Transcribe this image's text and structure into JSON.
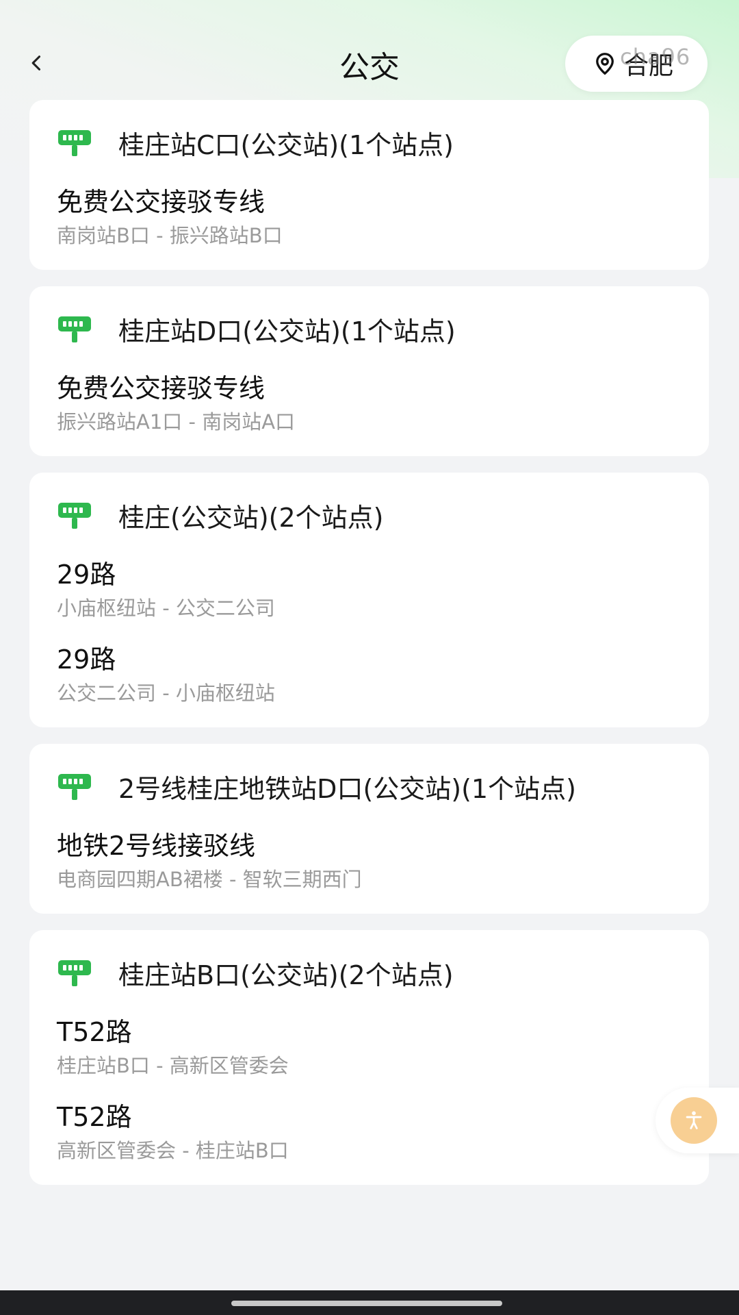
{
  "header": {
    "title": "公交",
    "city": "合肥",
    "watermark": "cha96"
  },
  "icons": {
    "back": "chevron-left-icon",
    "location": "location-pin-icon",
    "bus_stop": "bus-stop-icon",
    "accessibility": "accessibility-icon"
  },
  "colors": {
    "accent_green": "#2eb84e",
    "float_button": "#f8cf93"
  },
  "stops": [
    {
      "name": "桂庄站C口(公交站)(1个站点)",
      "routes": [
        {
          "name": "免费公交接驳专线",
          "direction": "南岗站B口 - 振兴路站B口"
        }
      ]
    },
    {
      "name": "桂庄站D口(公交站)(1个站点)",
      "routes": [
        {
          "name": "免费公交接驳专线",
          "direction": "振兴路站A1口 - 南岗站A口"
        }
      ]
    },
    {
      "name": "桂庄(公交站)(2个站点)",
      "routes": [
        {
          "name": "29路",
          "direction": "小庙枢纽站 - 公交二公司"
        },
        {
          "name": "29路",
          "direction": "公交二公司 - 小庙枢纽站"
        }
      ]
    },
    {
      "name": "2号线桂庄地铁站D口(公交站)(1个站点)",
      "routes": [
        {
          "name": "地铁2号线接驳线",
          "direction": "电商园四期AB裙楼 - 智软三期西门"
        }
      ]
    },
    {
      "name": "桂庄站B口(公交站)(2个站点)",
      "routes": [
        {
          "name": "T52路",
          "direction": "桂庄站B口 - 高新区管委会"
        },
        {
          "name": "T52路",
          "direction": "高新区管委会 - 桂庄站B口"
        }
      ]
    }
  ]
}
